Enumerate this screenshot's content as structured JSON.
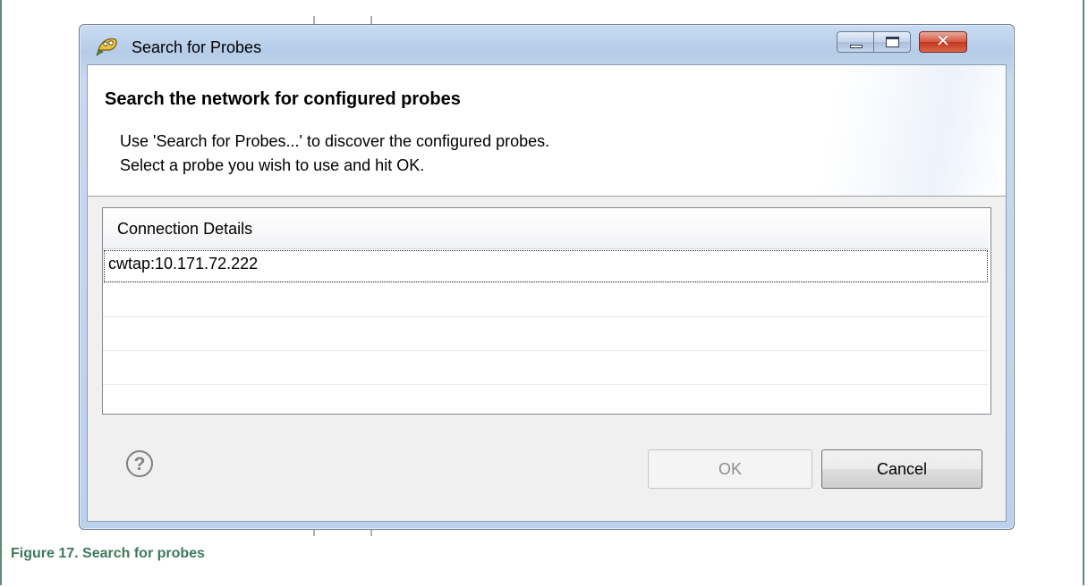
{
  "window": {
    "title": "Search for Probes",
    "controls": {
      "minimize_icon": "minimize-icon",
      "maximize_icon": "maximize-icon",
      "close_glyph": "✕"
    }
  },
  "header": {
    "title": "Search the network for configured probes",
    "lines": [
      "Use 'Search for Probes...' to discover the configured probes.",
      "Select a probe you wish to use and hit OK."
    ]
  },
  "table": {
    "columns": [
      "Connection Details"
    ],
    "rows": [
      "cwtap:10.171.72.222",
      "",
      "",
      ""
    ]
  },
  "footer": {
    "help_glyph": "?",
    "ok_label": "OK",
    "cancel_label": "Cancel",
    "ok_enabled": false
  },
  "caption": "Figure 17. Search for probes",
  "colors": {
    "caption": "#3d7a5c",
    "title_bar": "#c9dcf2",
    "close_button": "#c3351e"
  }
}
